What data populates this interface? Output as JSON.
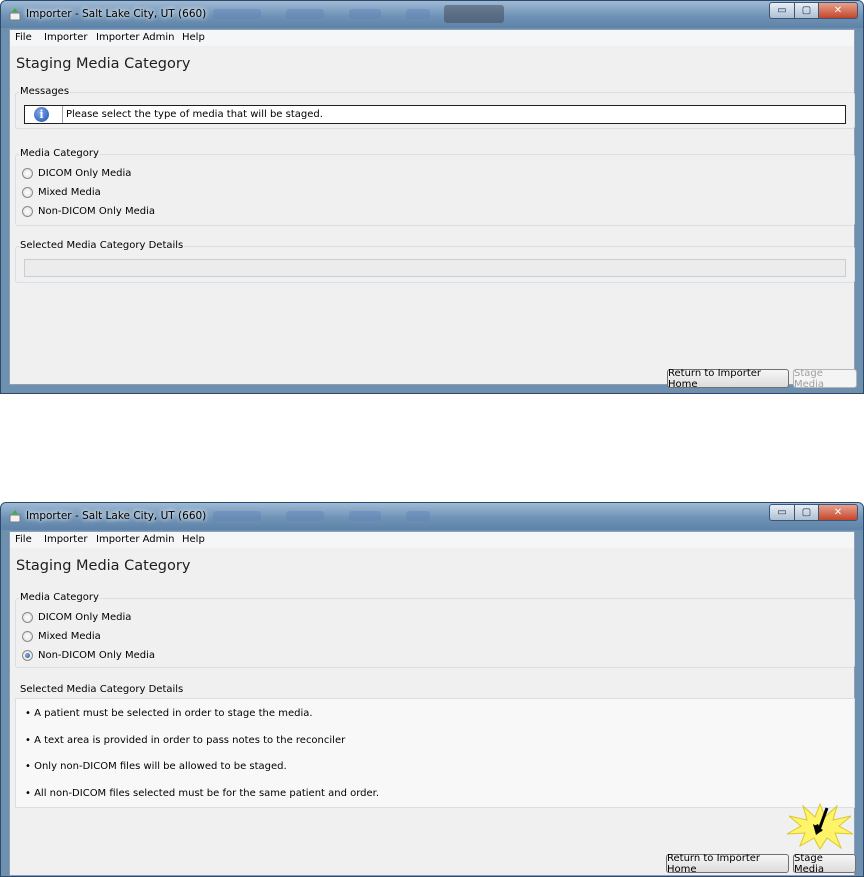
{
  "windows": [
    {
      "title": "Importer - Salt Lake City, UT (660)",
      "window_buttons": {
        "minimize": "▭",
        "maximize": "▢",
        "close": "✕"
      },
      "menu": [
        "File",
        "Importer",
        "Importer Admin",
        "Help"
      ],
      "page_title": "Staging Media Category",
      "messages": {
        "label": "Messages",
        "text": "Please select the type of media that will be staged.",
        "icon": "info-icon"
      },
      "media_category": {
        "label": "Media Category",
        "options": [
          {
            "label": "DICOM Only Media",
            "checked": false
          },
          {
            "label": "Mixed Media",
            "checked": false
          },
          {
            "label": "Non-DICOM Only Media",
            "checked": false
          }
        ]
      },
      "details": {
        "label": "Selected Media Category Details",
        "items": []
      },
      "buttons": {
        "return": "Return to Importer Home",
        "stage": "Stage Media",
        "stage_enabled": false
      }
    },
    {
      "title": "Importer - Salt Lake City, UT (660)",
      "window_buttons": {
        "minimize": "▭",
        "maximize": "▢",
        "close": "✕"
      },
      "menu": [
        "File",
        "Importer",
        "Importer Admin",
        "Help"
      ],
      "page_title": "Staging Media Category",
      "media_category": {
        "label": "Media Category",
        "options": [
          {
            "label": "DICOM Only Media",
            "checked": false
          },
          {
            "label": "Mixed Media",
            "checked": false
          },
          {
            "label": "Non-DICOM Only Media",
            "checked": true
          }
        ]
      },
      "details": {
        "label": "Selected Media Category Details",
        "items": [
          "• A patient must be selected in order to stage the media.",
          "• A text area is provided in order to pass notes to the reconciler",
          "• Only non-DICOM files will be allowed to be staged.",
          "• All non-DICOM files selected must be for the same patient and order."
        ]
      },
      "buttons": {
        "return": "Return to Importer Home",
        "stage": "Stage Media",
        "stage_enabled": true
      }
    }
  ],
  "colors": {
    "title_bar": "#6f93b6",
    "client_bg": "#f0f0f0",
    "highlight_burst": "#fff36a"
  }
}
